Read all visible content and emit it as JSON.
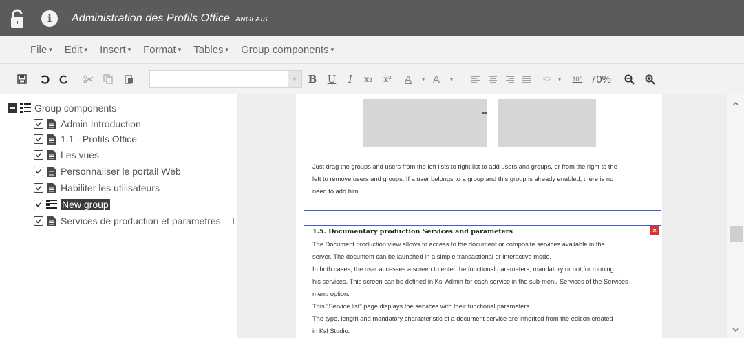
{
  "titlebar": {
    "title": "Administration des Profils Office",
    "language": "ANGLAIS",
    "icons": {
      "lock": "lock-icon",
      "info": "info-icon"
    }
  },
  "menubar": {
    "items": [
      {
        "label": "File",
        "caret": "▾"
      },
      {
        "label": "Edit",
        "caret": "▾"
      },
      {
        "label": "Insert",
        "caret": "▾"
      },
      {
        "label": "Format",
        "caret": "▾"
      },
      {
        "label": "Tables",
        "caret": "▾"
      },
      {
        "label": "Group components",
        "caret": "▾"
      }
    ]
  },
  "toolbar": {
    "bold": "B",
    "underline": "U",
    "italic": "I",
    "subscript": "x₂",
    "superscript": "x²",
    "font_color": "A",
    "bg_color": "A",
    "caret": "▾",
    "code": "<>",
    "zoom_100": "100",
    "zoom_value": "70%"
  },
  "tree": {
    "root_label": "Group components",
    "items": [
      {
        "label": "Admin Introduction",
        "type": "doc"
      },
      {
        "label": "1.1 - Profils Office",
        "type": "doc"
      },
      {
        "label": "Les vues",
        "type": "doc"
      },
      {
        "label": "Personnaliser le portail Web",
        "type": "doc"
      },
      {
        "label": "Habiliter les utilisateurs",
        "type": "doc"
      },
      {
        "label": "New group",
        "type": "group",
        "selected": true
      },
      {
        "label": "Services de production et parametres",
        "type": "doc"
      }
    ]
  },
  "document": {
    "image_separator": "••",
    "intro_lines": [
      "Just drag the groups and users from the left lists to right list to add users and groups, or from the right to the",
      "left to remove users and groups. If a user belongs to a group and this group is already enabled, there is no",
      "need to add him."
    ],
    "close_mark": "×",
    "heading": "1.5. Documentary production Services and parameters",
    "body_lines": [
      "The Document production view allows to access to the document or composite services available in the",
      "server. The document can be launched in a simple transactional or interactive mode.",
      "In both cases, the user accesses a screen to enter the functional parameters, mandatory or not,for running",
      "his services. This screen can be defined in Ksl Admin for each service in the sub-menu Services of the Services",
      "menu option.",
      "This \"Service list\" page displays the services with their functional parameters.",
      "The type, length and mandatory characteristic of a document service are inherited from the edition created",
      "in Ksl Studio."
    ]
  },
  "colors": {
    "titlebar": "#5b5b5b",
    "menubar": "#f2f2f2",
    "selection": "#3b3b3b",
    "edit_border": "#4a5cc8",
    "close_button": "#d9342b"
  }
}
